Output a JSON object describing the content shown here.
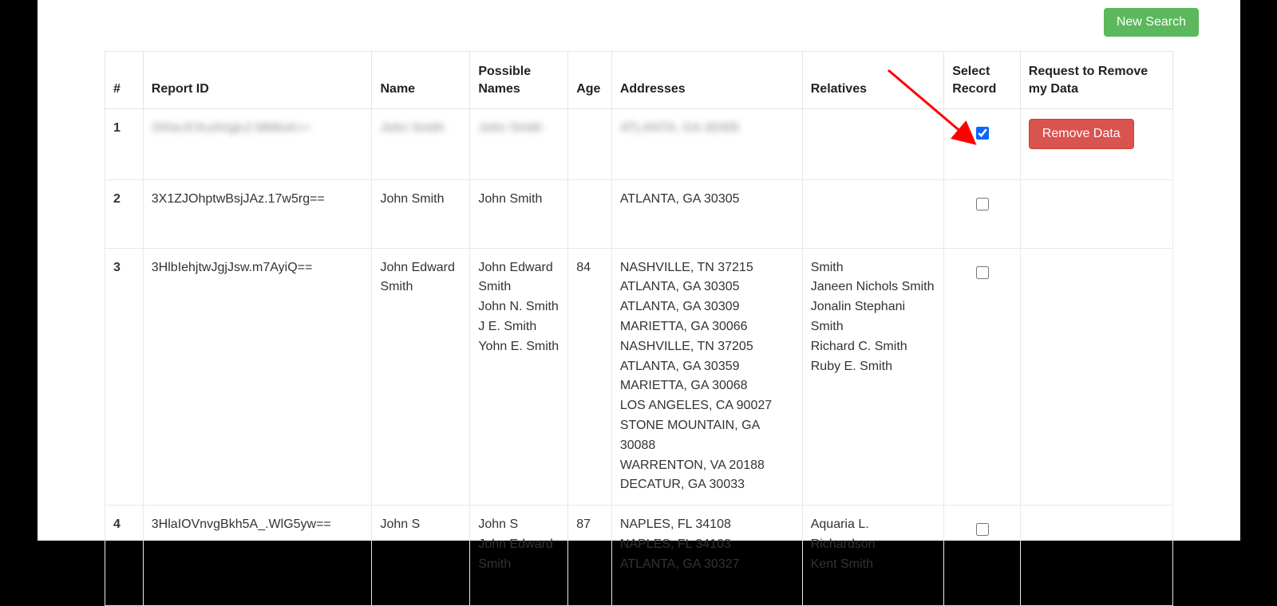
{
  "toolbar": {
    "newSearchLabel": "New Search"
  },
  "table": {
    "headers": {
      "num": "#",
      "reportId": "Report ID",
      "name": "Name",
      "possibleNames": "Possible Names",
      "age": "Age",
      "addresses": "Addresses",
      "relatives": "Relatives",
      "selectRecord": "Select Record",
      "requestRemove": "Request to Remove my Data"
    },
    "btn": {
      "removeData": "Remove Data"
    },
    "rows": [
      {
        "num": "1",
        "reportId": "3XheJCKuAVglc2.MMloA==",
        "name": "John Smith",
        "possibleNames": [
          "John Smith"
        ],
        "age": "",
        "addresses": [
          "ATLANTA, GA 30305"
        ],
        "relatives": [],
        "selected": true,
        "blurred": true
      },
      {
        "num": "2",
        "reportId": "3X1ZJOhptwBsjJAz.17w5rg==",
        "name": "John Smith",
        "possibleNames": [
          "John Smith"
        ],
        "age": "",
        "addresses": [
          "ATLANTA, GA 30305"
        ],
        "relatives": [],
        "selected": false,
        "blurred": false
      },
      {
        "num": "3",
        "reportId": "3HlbIehjtwJgjJsw.m7AyiQ==",
        "name": "John Edward Smith",
        "possibleNames": [
          "John Edward Smith",
          "John N. Smith",
          "J E. Smith",
          "Yohn E. Smith"
        ],
        "age": "84",
        "addresses": [
          "NASHVILLE, TN 37215",
          "ATLANTA, GA 30305",
          "ATLANTA, GA 30309",
          "MARIETTA, GA 30066",
          "NASHVILLE, TN 37205",
          "ATLANTA, GA 30359",
          "MARIETTA, GA 30068",
          "LOS ANGELES, CA 90027",
          "STONE MOUNTAIN, GA 30088",
          "WARRENTON, VA 20188",
          "DECATUR, GA 30033"
        ],
        "relatives": [
          "Smith",
          "Janeen Nichols Smith",
          "Jonalin Stephani Smith",
          "Richard C. Smith",
          "Ruby E. Smith"
        ],
        "selected": false,
        "blurred": false
      },
      {
        "num": "4",
        "reportId": "3HlaIOVnvgBkh5A_.WlG5yw==",
        "name": "John S",
        "possibleNames": [
          "John S",
          "John Edward Smith"
        ],
        "age": "87",
        "addresses": [
          "NAPLES, FL 34108",
          "NAPLES, FL 34103",
          "ATLANTA, GA 30327"
        ],
        "relatives": [
          "Aquaria L. Richardson",
          "Kent Smith"
        ],
        "selected": false,
        "blurred": false
      }
    ]
  },
  "annotation": {
    "arrowColor": "#ff0000"
  }
}
